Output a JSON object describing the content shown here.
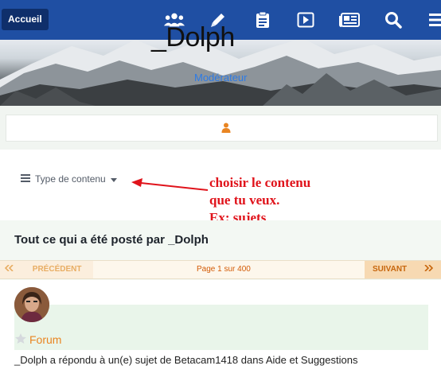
{
  "topbar": {
    "home_label": "Accueil",
    "icons": [
      "users-icon",
      "pen-icon",
      "clipboard-icon",
      "play-icon",
      "newspaper-icon",
      "search-icon",
      "menu-icon"
    ]
  },
  "profile": {
    "name": "_Dolph",
    "role": "Modérateur"
  },
  "filter": {
    "label": "Type de contenu"
  },
  "annotation": {
    "lines": [
      "choisir le contenu",
      "que tu veux.",
      "Ex: sujets"
    ]
  },
  "main": {
    "title": "Tout ce qui a été posté par _Dolph",
    "pager": {
      "prev": "PRÉCÉDENT",
      "page_info": "Page 1 sur 400",
      "next": "SUIVANT"
    },
    "result": {
      "forum": "Forum",
      "summary": "_Dolph a répondu à un(e) sujet de Betacam1418 dans Aide et Suggestions"
    }
  },
  "colors": {
    "topbar": "#1f4fa3",
    "accent": "#e98522",
    "annotation": "#e0131b",
    "role": "#2d7be6"
  }
}
